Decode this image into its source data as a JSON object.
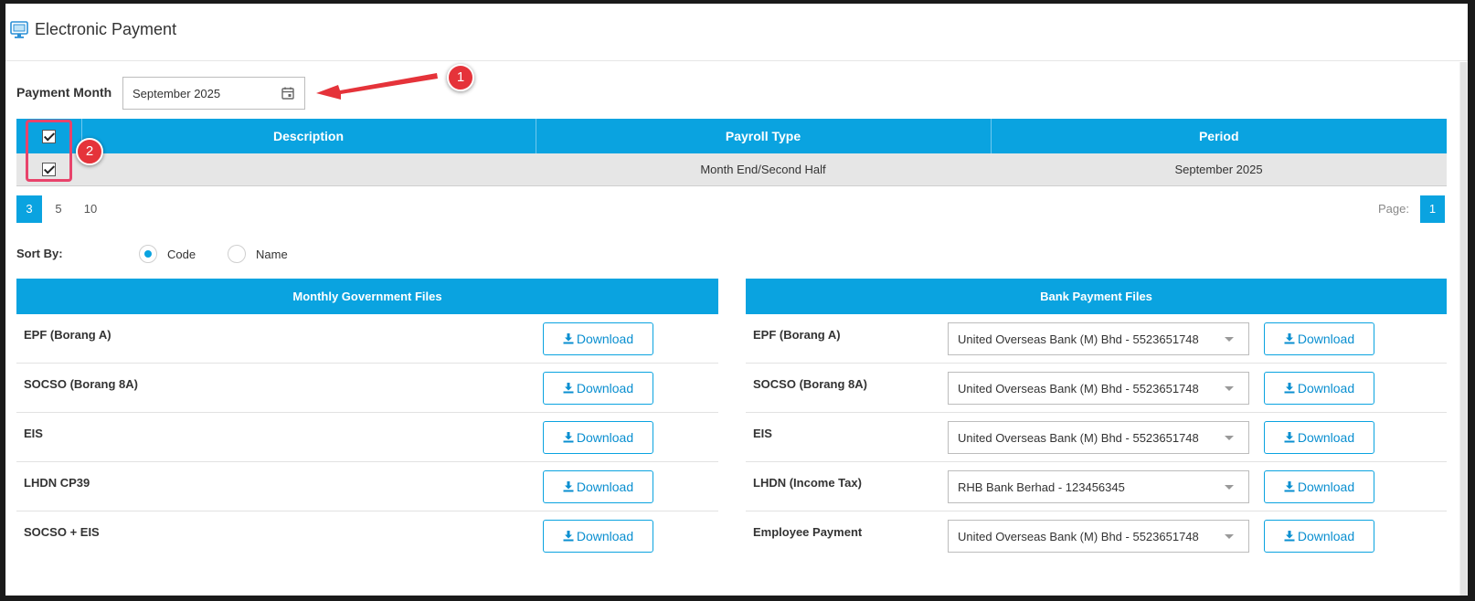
{
  "header": {
    "title": "Electronic Payment",
    "icon": "monitor-icon"
  },
  "payment_month": {
    "label": "Payment Month",
    "value": "September 2025",
    "icon": "calendar-icon"
  },
  "annotations": {
    "badge1": "1",
    "badge2": "2"
  },
  "table": {
    "columns": [
      "Description",
      "Payroll Type",
      "Period"
    ],
    "rows": [
      {
        "checked": true,
        "description": "",
        "payroll_type": "Month End/Second Half",
        "period": "September 2025"
      }
    ]
  },
  "pager": {
    "sizes": [
      "3",
      "5",
      "10"
    ],
    "active_size": "3",
    "page_label": "Page:",
    "current_page": "1"
  },
  "sort": {
    "label": "Sort By:",
    "options": [
      "Code",
      "Name"
    ],
    "selected": "Code"
  },
  "gov_files": {
    "title": "Monthly Government Files",
    "download_label": "Download",
    "rows": [
      {
        "label": "EPF (Borang A)"
      },
      {
        "label": "SOCSO (Borang 8A)"
      },
      {
        "label": "EIS"
      },
      {
        "label": "LHDN CP39"
      },
      {
        "label": "SOCSO + EIS"
      }
    ]
  },
  "bank_files": {
    "title": "Bank Payment Files",
    "download_label": "Download",
    "rows": [
      {
        "label": "EPF (Borang A)",
        "bank": "United Overseas Bank (M) Bhd - 5523651748"
      },
      {
        "label": "SOCSO (Borang 8A)",
        "bank": "United Overseas Bank (M) Bhd - 5523651748"
      },
      {
        "label": "EIS",
        "bank": "United Overseas Bank (M) Bhd - 5523651748"
      },
      {
        "label": "LHDN (Income Tax)",
        "bank": "RHB Bank Berhad - 123456345"
      },
      {
        "label": "Employee Payment",
        "bank": "United Overseas Bank (M) Bhd - 5523651748"
      }
    ]
  },
  "colors": {
    "accent": "#0aa3e0",
    "annotation_red": "#e5333a",
    "highlight_pink": "#e8436b"
  }
}
